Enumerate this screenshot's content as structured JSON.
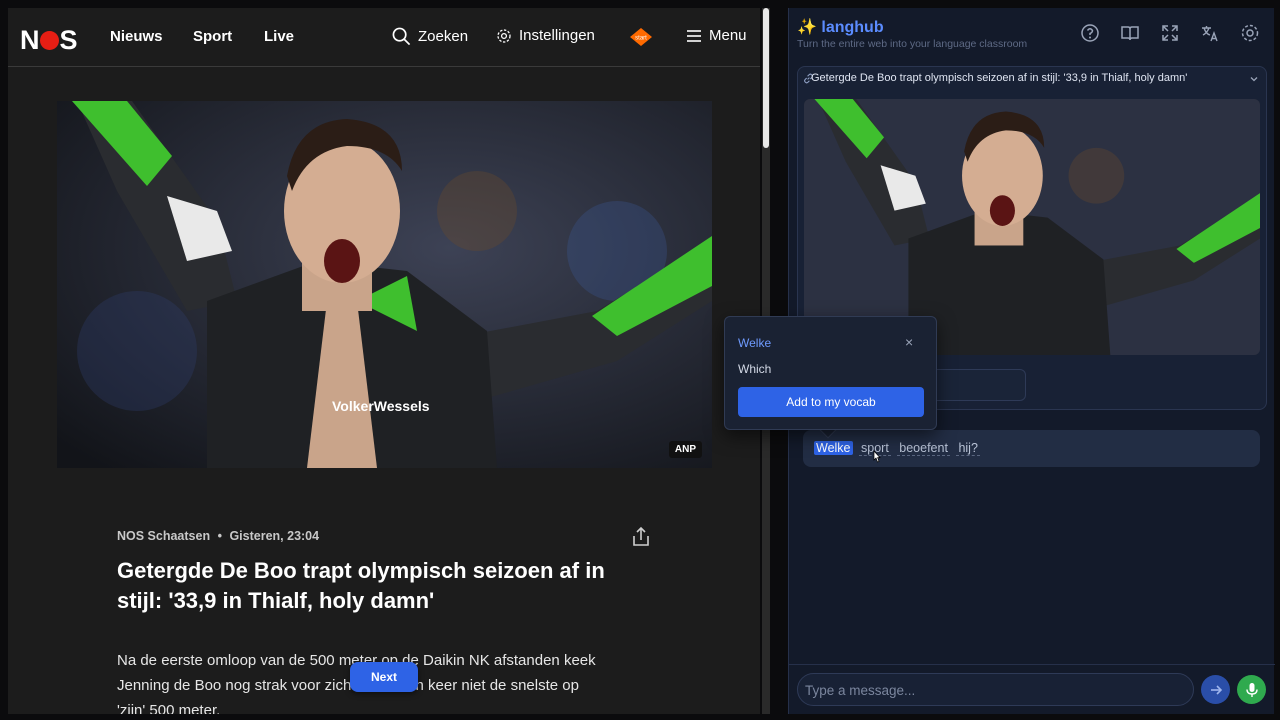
{
  "nos": {
    "logo": "NOS",
    "nav": [
      "Nieuws",
      "Sport",
      "Live"
    ],
    "search_label": "Zoeken",
    "settings_label": "Instellingen",
    "menu_label": "Menu",
    "npo_badge": "start",
    "hero_credit": "ANP",
    "meta": {
      "section": "NOS Schaatsen",
      "separator": "•",
      "date": "Gisteren, 23:04"
    },
    "headline": "Getergde De Boo trapt olympisch seizoen af in stijl: '33,9 in Thialf, holy damn'",
    "body_lines": [
      "Na de eerste omloop van de 500 meter op de Daikin NK afstanden keek",
      "Jenning de Boo nog strak voor zich... was een keer niet de snelste op",
      "'zijn' 500 meter."
    ],
    "next_button": "Next",
    "hero_sponsor_text": "VolkerWessels"
  },
  "panel": {
    "brand_icon": "✨",
    "brand": "langhub",
    "tagline": "Turn the entire web into your language classroom",
    "toolbar_icons": [
      "help-icon",
      "book-icon",
      "expand-icon",
      "translate-icon",
      "gear-icon"
    ],
    "card": {
      "title": "Getergde De Boo trapt olympisch seizoen af in stijl: '33,9 in Thialf, holy damn'",
      "button_fragment": "ge"
    },
    "question_words": [
      "Welke",
      "sport",
      "beoefent",
      "hij?"
    ],
    "composer_placeholder": "Type a message..."
  },
  "popup": {
    "word": "Welke",
    "translation": "Which",
    "add_button": "Add to my vocab",
    "close": "×"
  },
  "colors": {
    "accent": "#2e63e6",
    "nos_red": "#e61e14",
    "mic_green": "#2faa4e",
    "panel_bg": "#131a2a"
  }
}
